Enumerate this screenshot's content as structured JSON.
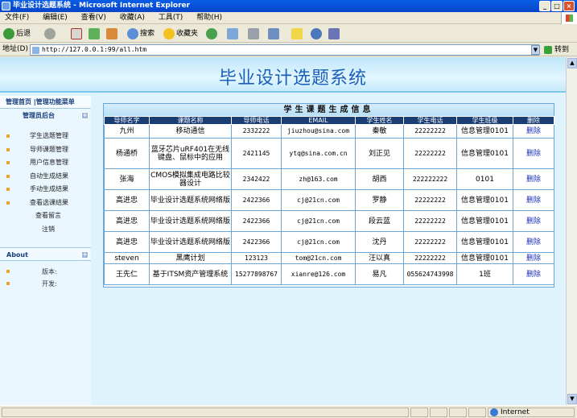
{
  "window": {
    "title": "毕业设计选题系统 - Microsoft Internet Explorer",
    "min": "_",
    "max": "□",
    "close": "×"
  },
  "menu": [
    "文件(F)",
    "编辑(E)",
    "查看(V)",
    "收藏(A)",
    "工具(T)",
    "帮助(H)"
  ],
  "toolbar": {
    "back": "后退",
    "search": "搜索",
    "favorites": "收藏夹"
  },
  "address": {
    "label": "地址(D)",
    "url": "http://127.0.0.1:99/all.htm",
    "go": "转到"
  },
  "banner": {
    "title": "毕业设计选题系统"
  },
  "sidebar": {
    "top_links": "管理首页 |管理功能菜单",
    "admin_header": "管理员后台",
    "items": [
      "学生选题管理",
      "导师课题管理",
      "用户信息管理",
      "自动生成结果",
      "手动生成结果",
      "查看选课结果",
      "查看留言",
      "注销"
    ],
    "about": {
      "title": "About",
      "version": "版本:",
      "developer": "开发:"
    }
  },
  "panel": {
    "title": "学生课题生成信息",
    "columns": [
      "导师名字",
      "课题名称",
      "导师电话",
      "EMAIL",
      "学生姓名",
      "学生电话",
      "学生班级",
      "删除"
    ],
    "rows": [
      [
        "九州",
        "移动通信",
        "2332222",
        "jiuzhou@sina.com",
        "秦敏",
        "22222222",
        "信息管理0101",
        "删除"
      ],
      [
        "杨通桥",
        "蓝牙芯片uRF401在无线键盘、鼠标中的应用",
        "2421145",
        "ytq@sina.com.cn",
        "刘正见",
        "22222222",
        "信息管理0101",
        "删除"
      ],
      [
        "张海",
        "CMOS模拟集成电路比较器设计",
        "2342422",
        "zh@163.com",
        "胡西",
        "222222222",
        "0101",
        "删除"
      ],
      [
        "高进忠",
        "毕业设计选题系统网络版",
        "2422366",
        "cj@21cn.com",
        "罗静",
        "22222222",
        "信息管理0101",
        "删除"
      ],
      [
        "高进忠",
        "毕业设计选题系统网络版",
        "2422366",
        "cj@21cn.com",
        "段云蓝",
        "22222222",
        "信息管理0101",
        "删除"
      ],
      [
        "高进忠",
        "毕业设计选题系统网络版",
        "2422366",
        "cj@21cn.com",
        "沈丹",
        "22222222",
        "信息管理0101",
        "删除"
      ],
      [
        "steven",
        "黑鹰计划",
        "123123",
        "tom@21cn.com",
        "汪以真",
        "22222222",
        "信息管理0101",
        "删除"
      ],
      [
        "王先仁",
        "基于ITSM资产管理系统",
        "15277898767",
        "xianre@126.com",
        "易凡",
        "055624743998",
        "1班",
        "删除"
      ]
    ]
  },
  "status": {
    "zone": "Internet"
  }
}
